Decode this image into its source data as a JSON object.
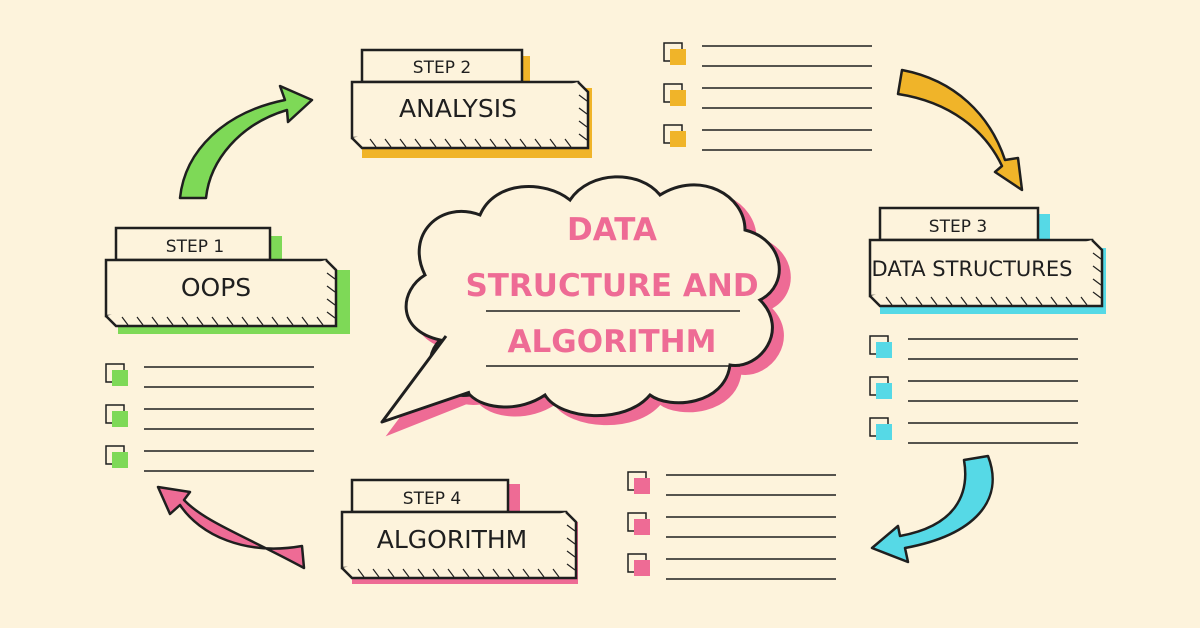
{
  "title": {
    "lines": [
      "DATA",
      "STRUCTURE AND",
      "ALGORITHM"
    ]
  },
  "steps": [
    {
      "tag": "STEP 1",
      "name": "OOPS"
    },
    {
      "tag": "STEP 2",
      "name": "ANALYSIS"
    },
    {
      "tag": "STEP 3",
      "name": "DATA STRUCTURES"
    },
    {
      "tag": "STEP 4",
      "name": "ALGORITHM"
    }
  ],
  "colors": {
    "background": "#fdf3dc",
    "step1": "#7ed957",
    "step2": "#f0b429",
    "step3": "#56d9e6",
    "step4": "#ee6b95",
    "title": "#ee6b95",
    "ink": "#1f1f1f"
  },
  "icons": {
    "arrow_1_to_2": "green-curved-arrow",
    "arrow_2_to_3": "yellow-curved-arrow",
    "arrow_3_to_4": "cyan-curved-arrow",
    "arrow_4_to_1": "pink-curved-arrow",
    "checklist_box": "checkbox-icon",
    "center": "speech-cloud-icon"
  }
}
